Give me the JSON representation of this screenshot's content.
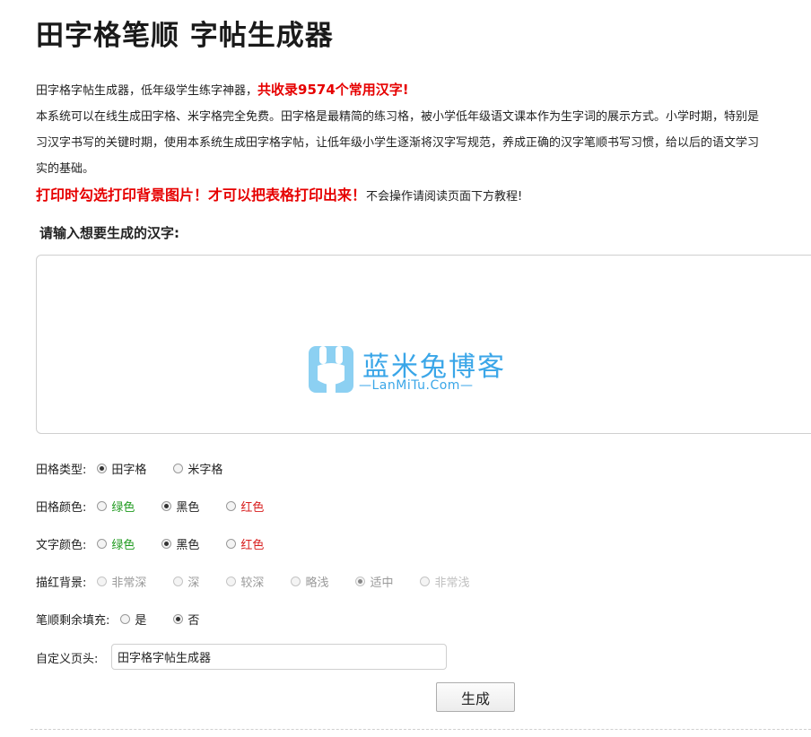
{
  "page": {
    "title": "田字格笔顺 字帖生成器"
  },
  "intro": {
    "line1_text": "田字格字帖生成器，低年级学生练字神器，",
    "line1_highlight": "共收录9574个常用汉字!",
    "para_line1": "本系统可以在线生成田字格、米字格完全免费。田字格是最精简的练习格，被小学低年级语文课本作为生字词的展示方式。小学时期，特别是",
    "para_line2": "习汉字书写的关键时期，使用本系统生成田字格字帖，让低年级小学生逐渐将汉字写规范，养成正确的汉字笔顺书写习惯，给以后的语文学习",
    "para_line3": "实的基础。",
    "warning": "打印时勾选打印背景图片！才可以把表格打印出来！",
    "warning_note": "不会操作请阅读页面下方教程!"
  },
  "input_section": {
    "label": "请输入想要生成的汉字:",
    "value": ""
  },
  "watermark": {
    "name": "蓝米兔博客",
    "url": "—LanMiTu.Com—",
    "color": "#3aa6e8"
  },
  "options": {
    "grid_type": {
      "label": "田格类型:",
      "choices": [
        "田字格",
        "米字格"
      ],
      "selected": "田字格"
    },
    "grid_color": {
      "label": "田格颜色:",
      "choices": [
        "绿色",
        "黑色",
        "红色"
      ],
      "selected": "黑色"
    },
    "text_color": {
      "label": "文字颜色:",
      "choices": [
        "绿色",
        "黑色",
        "红色"
      ],
      "selected": "黑色"
    },
    "trace_bg": {
      "label": "描红背景:",
      "choices": [
        "非常深",
        "深",
        "较深",
        "略浅",
        "适中",
        "非常浅"
      ],
      "selected": "适中"
    },
    "stroke_fill": {
      "label": "笔顺剩余填充:",
      "choices": [
        "是",
        "否"
      ],
      "selected": "否"
    }
  },
  "custom_header": {
    "label": "自定义页头:",
    "value": "田字格字帖生成器"
  },
  "generate_button": "生成",
  "colors": {
    "green": "#1e9a1e",
    "red": "#d81e1e",
    "highlight_red": "#e60000"
  }
}
